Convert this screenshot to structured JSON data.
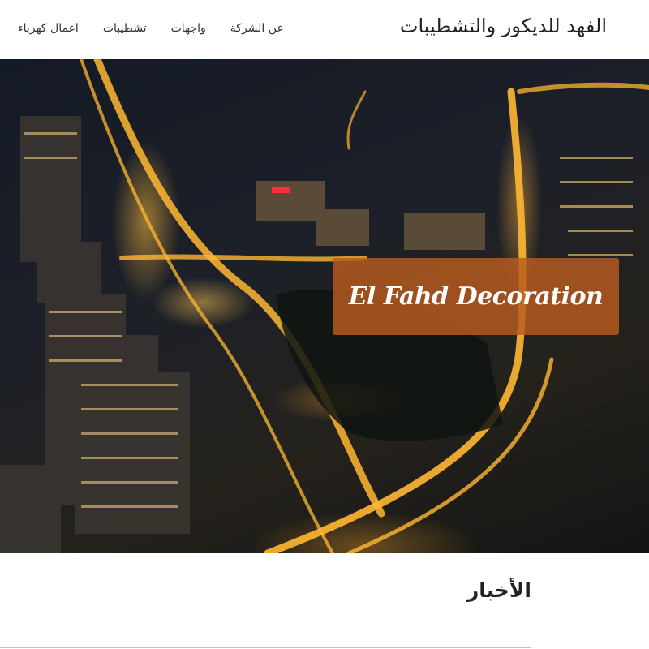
{
  "header": {
    "brand": "الفهد للديكور والتشطيبات",
    "nav": [
      {
        "label": "عن الشركة"
      },
      {
        "label": "واجهات"
      },
      {
        "label": "تشطيبات"
      },
      {
        "label": "اعمال كهرباء"
      }
    ]
  },
  "hero": {
    "caption": "El Fahd Decoration",
    "accent_color": "#b95c1e"
  },
  "news": {
    "title": "الأخبار"
  }
}
